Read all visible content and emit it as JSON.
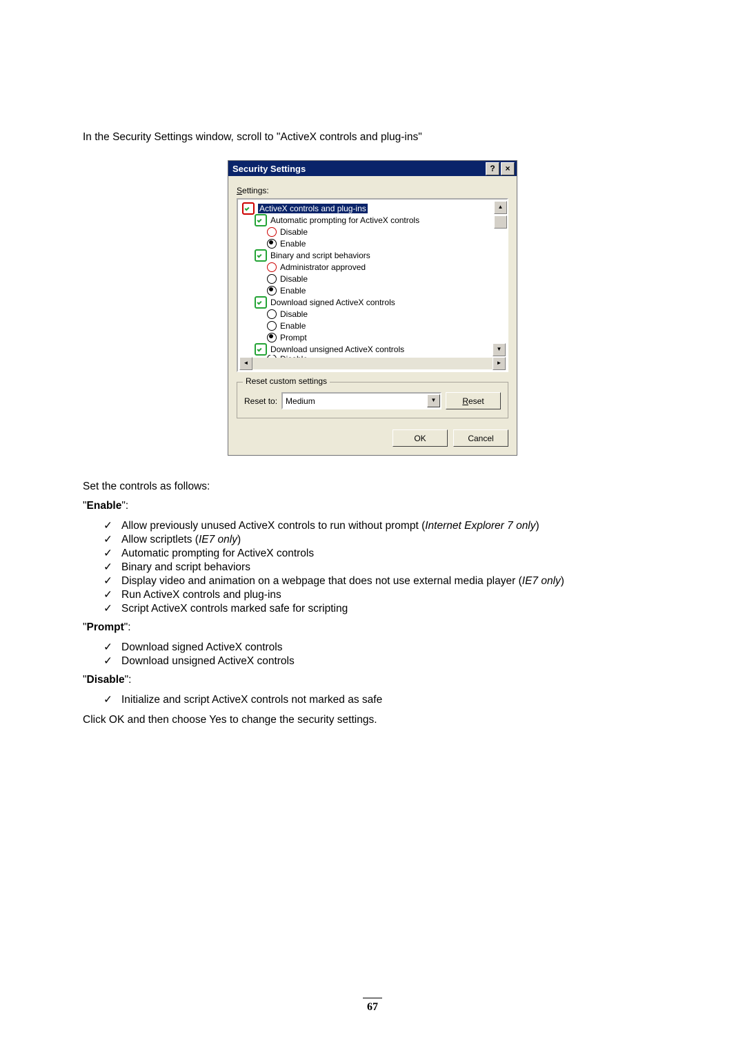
{
  "intro": "In the Security Settings window, scroll to \"ActiveX controls and plug-ins\"",
  "dialog": {
    "title": "Security Settings",
    "help_glyph": "?",
    "close_glyph": "×",
    "settings_label_prefix": "S",
    "settings_label_rest": "ettings:",
    "tree": {
      "cat0": "ActiveX controls and plug-ins",
      "cat1": "Automatic prompting for ActiveX controls",
      "opt_disable": "Disable",
      "opt_enable": "Enable",
      "cat2": "Binary and script behaviors",
      "opt_admin": "Administrator approved",
      "cat3": "Download signed ActiveX controls",
      "opt_prompt": "Prompt",
      "cat4": "Download unsigned ActiveX controls",
      "opt_disable_cut": "Disable"
    },
    "reset_legend": "Reset custom settings",
    "reset_to_prefix": "R",
    "reset_to_rest": "eset to:",
    "reset_value": "Medium",
    "reset_btn_prefix": "R",
    "reset_btn_rest": "eset",
    "ok": "OK",
    "cancel": "Cancel"
  },
  "body": {
    "p_set": "Set the controls as follows:",
    "enable_hdr": "Enable",
    "prompt_hdr": "Prompt",
    "disable_hdr": "Disable",
    "enable_items": {
      "i0a": "Allow previously unused ActiveX controls to run without prompt (",
      "i0b": "Internet Explorer 7 only",
      "i0c": ")",
      "i1a": "Allow scriptlets (",
      "i1b": "IE7 only",
      "i1c": ")",
      "i2": "Automatic prompting for ActiveX controls",
      "i3": "Binary and script behaviors",
      "i4a": "Display video and animation on a webpage that does not use external media player (",
      "i4b": "IE7 only",
      "i4c": ")",
      "i5": "Run ActiveX controls and plug-ins",
      "i6": "Script ActiveX controls marked safe for scripting"
    },
    "prompt_items": {
      "i0": "Download signed ActiveX controls",
      "i1": "Download unsigned ActiveX controls"
    },
    "disable_items": {
      "i0": "Initialize and script ActiveX controls not marked as safe"
    },
    "p_click": "Click OK and then choose Yes to change the security settings."
  },
  "page_number": "67"
}
